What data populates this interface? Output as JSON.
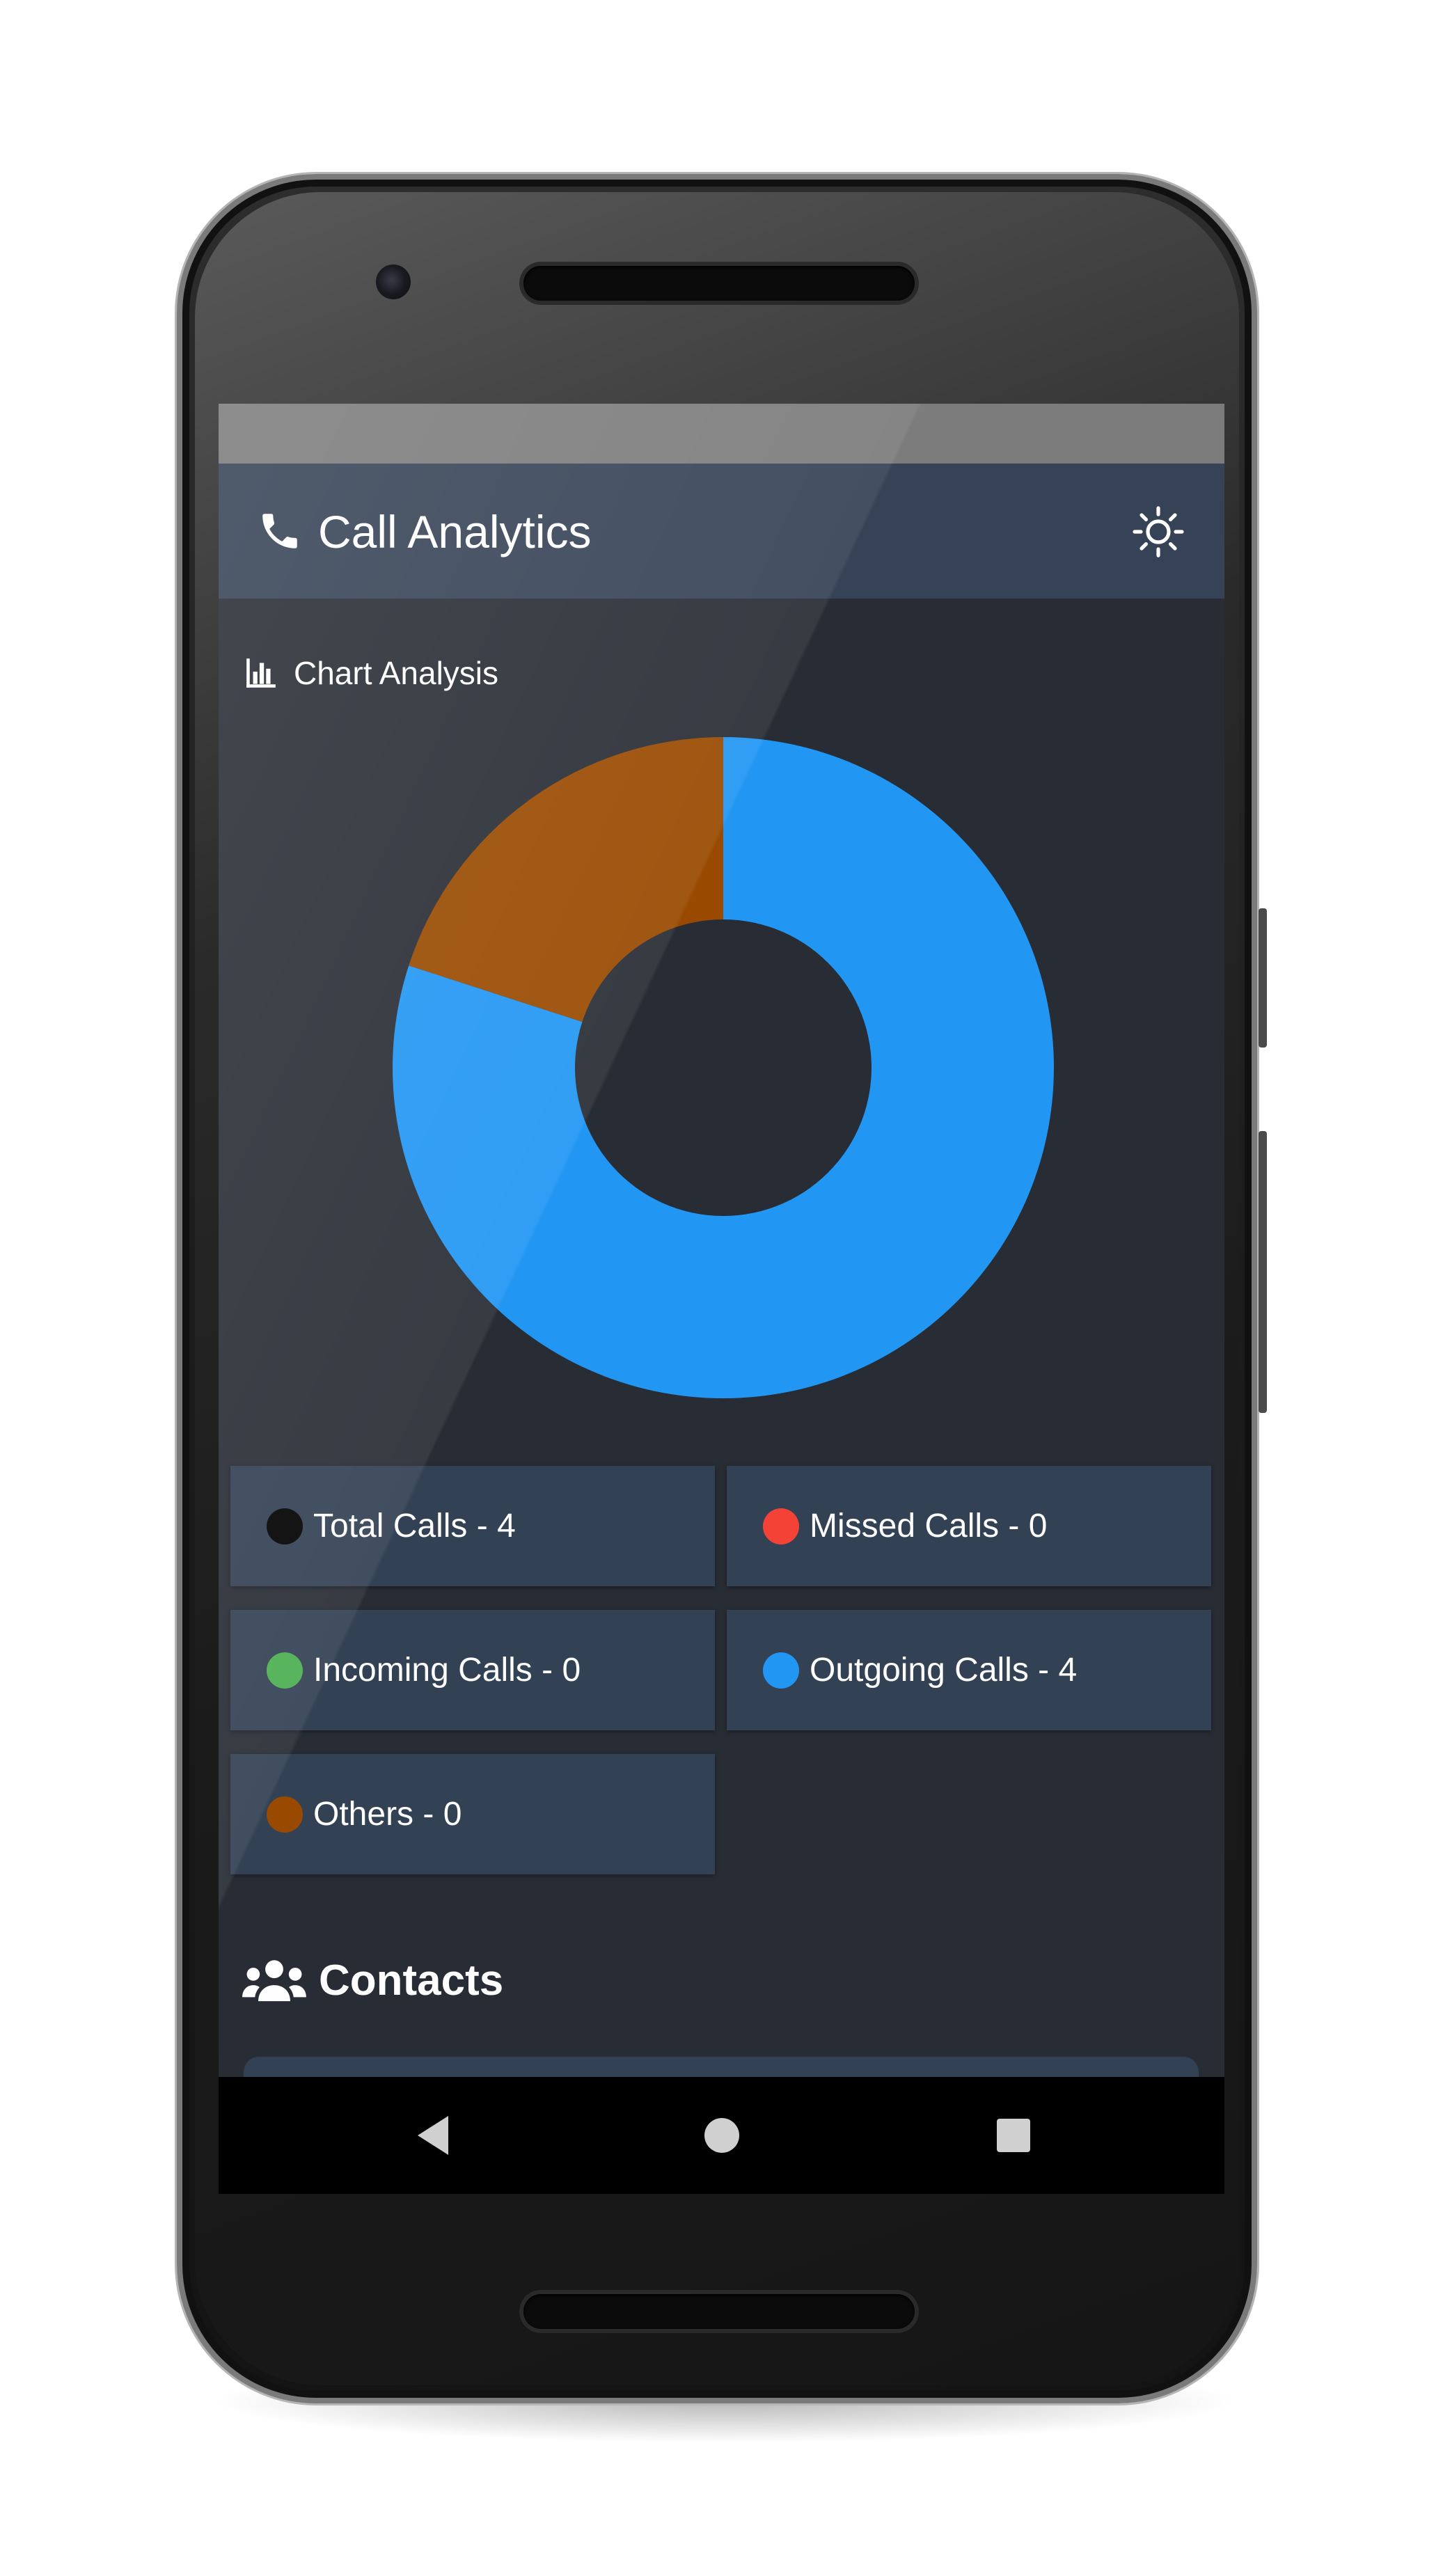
{
  "app": {
    "title": "Call Analytics",
    "icons": {
      "title": "phone-icon",
      "theme_toggle": "sun-icon"
    }
  },
  "chart_section": {
    "heading": "Chart Analysis",
    "icon": "bar-chart-icon"
  },
  "chart_data": {
    "type": "pie",
    "variant": "donut",
    "categories": [
      "Outgoing Calls",
      "Others"
    ],
    "values": [
      80,
      20
    ],
    "colors": [
      "#2196f3",
      "#994a00"
    ],
    "title": "",
    "legend": "below"
  },
  "legend_cards": [
    {
      "label": "Total Calls - 4",
      "color": "#000000"
    },
    {
      "label": "Missed Calls - 0",
      "color": "#f44336"
    },
    {
      "label": "Incoming Calls - 0",
      "color": "#4caf50"
    },
    {
      "label": "Outgoing Calls - 4",
      "color": "#2196f3"
    },
    {
      "label": "Others - 0",
      "color": "#994a00"
    }
  ],
  "contacts": {
    "heading": "Contacts",
    "icon": "users-icon"
  },
  "nav": {
    "icons": [
      "back-triangle-icon",
      "home-circle-icon",
      "recents-square-icon"
    ]
  },
  "theme": {
    "background": "#282c34",
    "app_bar": "#364356",
    "card": "#334154"
  }
}
